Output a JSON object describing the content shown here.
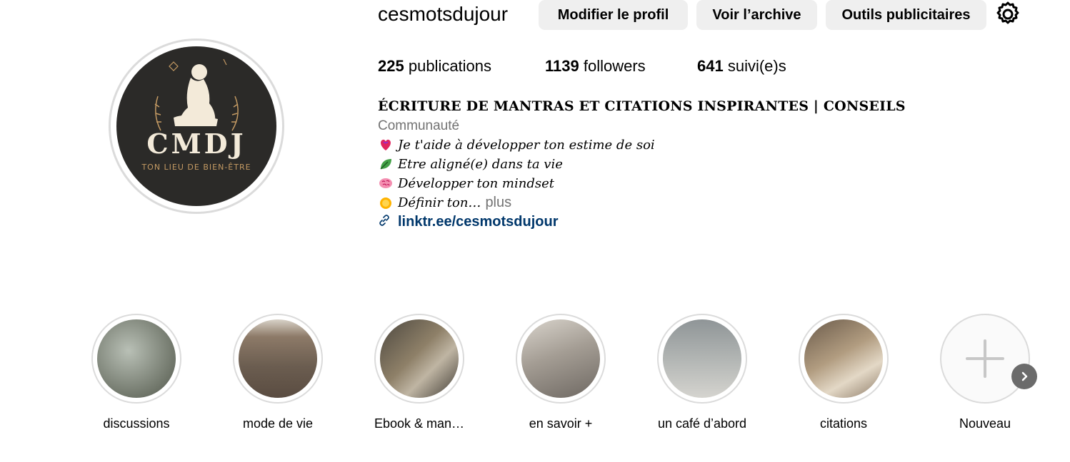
{
  "profile": {
    "username": "cesmotsdujour",
    "avatar": {
      "letters": "CMDJ",
      "tagline": "TON LIEU DE BIEN-ÊTRE"
    }
  },
  "actions": {
    "edit_label": "Modifier le profil",
    "archive_label": "Voir l’archive",
    "ads_label": "Outils publicitaires",
    "settings_icon": "gear-icon"
  },
  "stats": {
    "posts_count": "225",
    "posts_label": "publications",
    "followers_count": "1139",
    "followers_label": "followers",
    "following_count": "641",
    "following_label": "suivi(e)s"
  },
  "bio": {
    "title": "ÉCRITURE DE MANTRAS ET CITATIONS INSPIRANTES | CONSEILS",
    "category": "Communauté",
    "lines": [
      {
        "icon": "heart-icon",
        "text": "Je t'aide à développer ton estime de soi"
      },
      {
        "icon": "leaf-icon",
        "text": "Etre aligné(e) dans ta vie"
      },
      {
        "icon": "brain-icon",
        "text": "Développer ton mindset"
      },
      {
        "icon": "sun-icon",
        "text": "Définir ton…"
      }
    ],
    "more_label": "plus",
    "link": "linktr.ee/cesmotsdujour"
  },
  "highlights": [
    {
      "label": "discussions",
      "color": "#8a8f86"
    },
    {
      "label": "mode de vie",
      "color": "#6b5d50"
    },
    {
      "label": "Ebook & man…",
      "color": "#7d6f60"
    },
    {
      "label": "en savoir +",
      "color": "#8e8780"
    },
    {
      "label": "un café d’abord",
      "color": "#a7aaa8"
    },
    {
      "label": "citations",
      "color": "#9b8b77"
    },
    {
      "label": "Nouveau",
      "color": "#fafafa"
    }
  ],
  "colors": {
    "link": "#00376b",
    "muted": "#737373",
    "button_bg": "#efefef",
    "ring": "#dbdbdb"
  }
}
